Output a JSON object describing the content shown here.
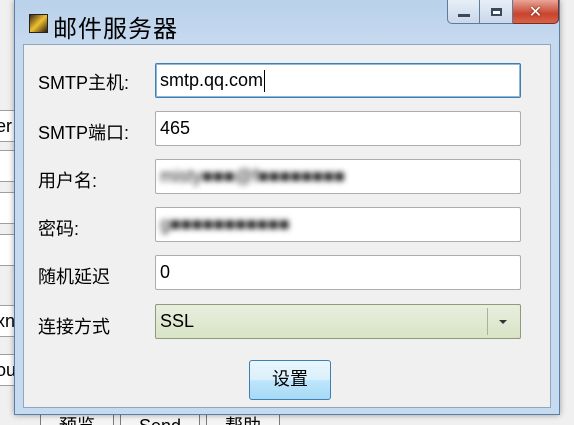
{
  "background": {
    "field_fragments": [
      "er",
      "",
      "",
      "",
      "",
      "",
      "xn",
      "ou"
    ],
    "bottom_tabs": [
      "预览",
      "Send",
      "帮助"
    ]
  },
  "window": {
    "title": "邮件服务器",
    "buttons": {
      "minimize": "minimize",
      "maximize": "maximize",
      "close": "✕"
    }
  },
  "form": {
    "smtp_host": {
      "label": "SMTP主机:",
      "value": "smtp.qq.com"
    },
    "smtp_port": {
      "label": "SMTP端口:",
      "value": "465"
    },
    "username": {
      "label": "用户名:",
      "value": "misty■■■@f■■■■■■■■"
    },
    "password": {
      "label": "密码:",
      "value": "g■■■■■■■■■■■"
    },
    "random_delay": {
      "label": "随机延迟",
      "value": "0"
    },
    "connection": {
      "label": "连接方式",
      "selected": "SSL"
    },
    "submit_label": "设置"
  }
}
